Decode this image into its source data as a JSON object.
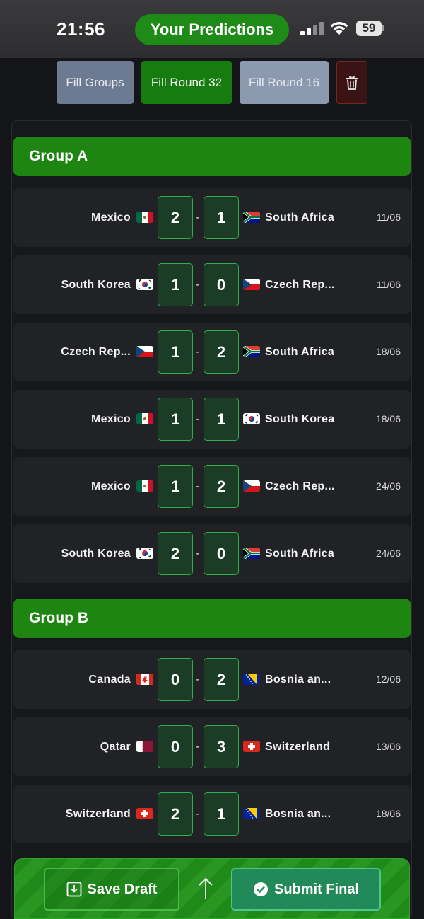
{
  "status_bar": {
    "time": "21:56",
    "battery": "59"
  },
  "header": {
    "title": "Your Predictions"
  },
  "toolbar": {
    "fill_groups": "Fill Groups",
    "fill_round32": "Fill Round 32",
    "fill_round16": "Fill Round 16"
  },
  "groups": [
    {
      "name": "Group A",
      "matches": [
        {
          "home": "Mexico",
          "home_flag": "mexico-flag",
          "home_score": "2",
          "away_score": "1",
          "away": "South Africa",
          "away_flag": "south-africa-flag",
          "date": "11/06"
        },
        {
          "home": "South Korea",
          "home_flag": "south-korea-flag",
          "home_score": "1",
          "away_score": "0",
          "away": "Czech Rep...",
          "away_flag": "czech-flag",
          "date": "11/06"
        },
        {
          "home": "Czech Rep...",
          "home_flag": "czech-flag",
          "home_score": "1",
          "away_score": "2",
          "away": "South Africa",
          "away_flag": "south-africa-flag",
          "date": "18/06"
        },
        {
          "home": "Mexico",
          "home_flag": "mexico-flag",
          "home_score": "1",
          "away_score": "1",
          "away": "South Korea",
          "away_flag": "south-korea-flag",
          "date": "18/06"
        },
        {
          "home": "Mexico",
          "home_flag": "mexico-flag",
          "home_score": "1",
          "away_score": "2",
          "away": "Czech Rep...",
          "away_flag": "czech-flag",
          "date": "24/06"
        },
        {
          "home": "South Korea",
          "home_flag": "south-korea-flag",
          "home_score": "2",
          "away_score": "0",
          "away": "South Africa",
          "away_flag": "south-africa-flag",
          "date": "24/06"
        }
      ]
    },
    {
      "name": "Group B",
      "matches": [
        {
          "home": "Canada",
          "home_flag": "canada-flag",
          "home_score": "0",
          "away_score": "2",
          "away": "Bosnia an...",
          "away_flag": "bosnia-flag",
          "date": "12/06"
        },
        {
          "home": "Qatar",
          "home_flag": "qatar-flag",
          "home_score": "0",
          "away_score": "3",
          "away": "Switzerland",
          "away_flag": "switzerland-flag",
          "date": "13/06"
        },
        {
          "home": "Switzerland",
          "home_flag": "switzerland-flag",
          "home_score": "2",
          "away_score": "1",
          "away": "Bosnia an...",
          "away_flag": "bosnia-flag",
          "date": "18/06"
        }
      ]
    }
  ],
  "score_separator": "-",
  "footer": {
    "save_draft": "Save Draft",
    "submit_final": "Submit Final"
  },
  "colors": {
    "accent_green": "#1e8513",
    "score_border": "#2fae4d",
    "background": "#141518"
  }
}
